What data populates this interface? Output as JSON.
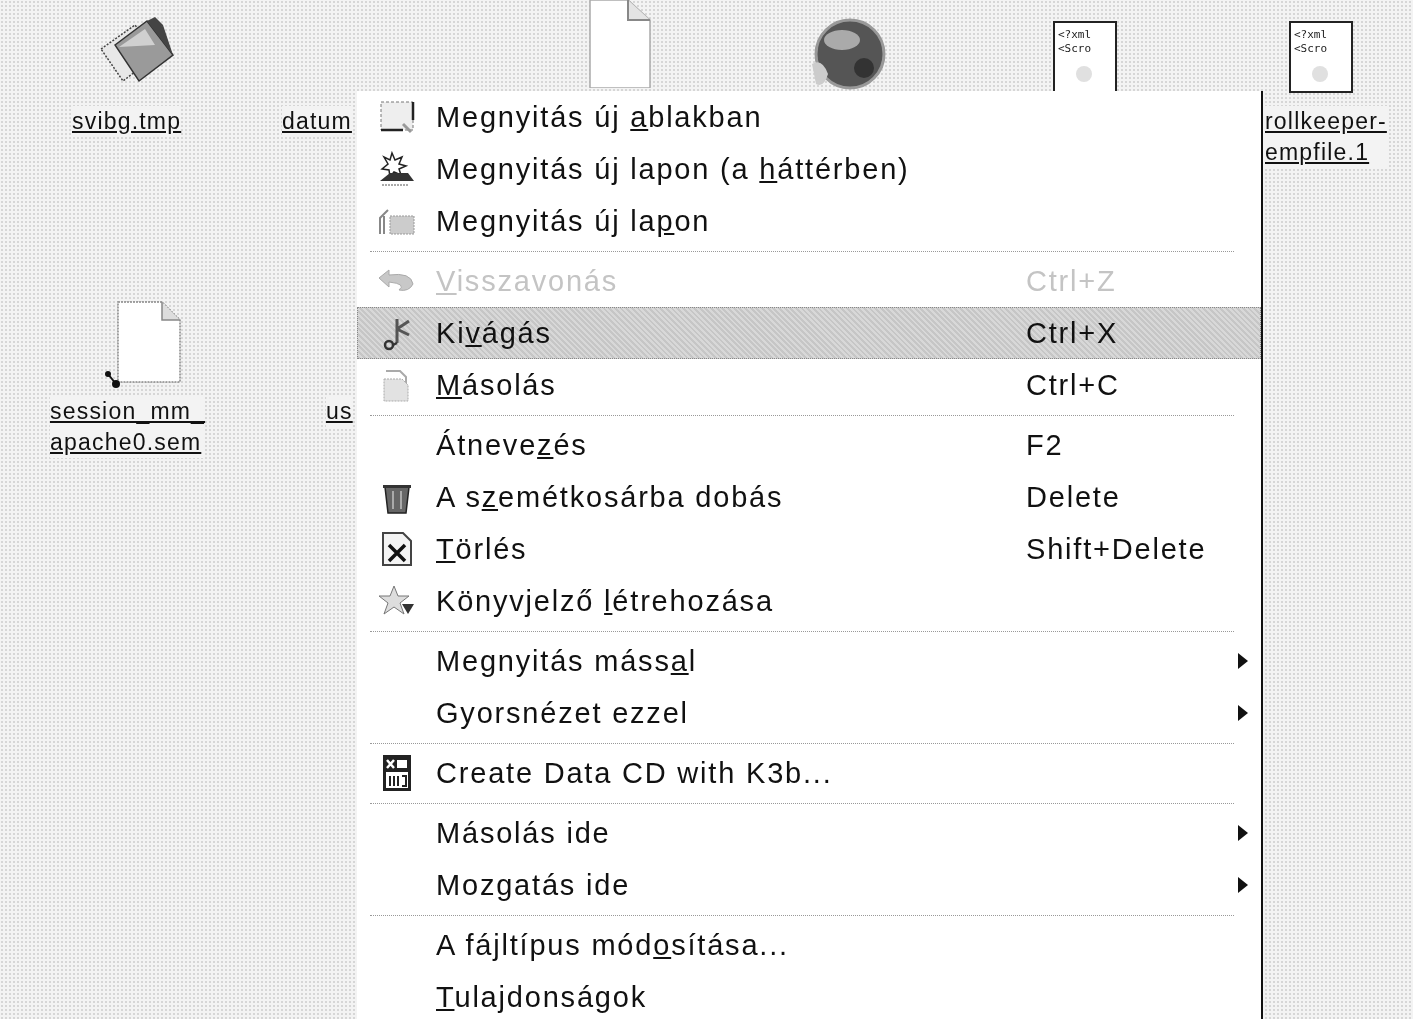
{
  "desktop_icons": [
    {
      "kind": "package",
      "label_lines": [
        "svibg.tmp"
      ]
    },
    {
      "kind": "label_only",
      "label_lines": [
        "datum"
      ]
    },
    {
      "kind": "document",
      "label_lines": [
        "session_mm_",
        "apache0.sem"
      ]
    },
    {
      "kind": "label_only",
      "label_lines": [
        "us"
      ]
    },
    {
      "kind": "document_top"
    },
    {
      "kind": "globe"
    },
    {
      "kind": "xml",
      "preview": [
        "<?xml",
        "<Scro"
      ]
    },
    {
      "kind": "xml",
      "preview": [
        "<?xml",
        "<Scro"
      ],
      "label_lines": [
        "rollkeeper-",
        "empfile.1"
      ]
    }
  ],
  "context_menu": {
    "items": [
      {
        "kind": "item",
        "label": [
          {
            "text": "Megnyitás új ",
            "underline": false
          },
          {
            "text": "a",
            "underline": true
          },
          {
            "text": "blakban",
            "underline": false
          }
        ],
        "disabled": false,
        "selected": false,
        "submenu": false
      },
      {
        "kind": "item",
        "label": [
          {
            "text": "Megnyitás új lapon (a ",
            "underline": false
          },
          {
            "text": "h",
            "underline": true
          },
          {
            "text": "áttérben)",
            "underline": false
          }
        ],
        "disabled": false,
        "selected": false,
        "submenu": false
      },
      {
        "kind": "item",
        "label": [
          {
            "text": "Megnyitás új la",
            "underline": false
          },
          {
            "text": "p",
            "underline": true
          },
          {
            "text": "on",
            "underline": false
          }
        ],
        "disabled": false,
        "selected": false,
        "submenu": false
      },
      {
        "kind": "separator"
      },
      {
        "kind": "item",
        "label": [
          {
            "text": "V",
            "underline": true
          },
          {
            "text": "isszavonás",
            "underline": false
          }
        ],
        "shortcut": "Ctrl+Z",
        "disabled": true,
        "selected": false,
        "submenu": false
      },
      {
        "kind": "item",
        "label": [
          {
            "text": "Ki",
            "underline": false
          },
          {
            "text": "v",
            "underline": true
          },
          {
            "text": "ágás",
            "underline": false
          }
        ],
        "shortcut": "Ctrl+X",
        "disabled": false,
        "selected": true,
        "submenu": false
      },
      {
        "kind": "item",
        "label": [
          {
            "text": "M",
            "underline": true
          },
          {
            "text": "ásolás",
            "underline": false
          }
        ],
        "shortcut": "Ctrl+C",
        "disabled": false,
        "selected": false,
        "submenu": false
      },
      {
        "kind": "separator"
      },
      {
        "kind": "item",
        "label": [
          {
            "text": "Átneve",
            "underline": false
          },
          {
            "text": "z",
            "underline": true
          },
          {
            "text": "és",
            "underline": false
          }
        ],
        "shortcut": "F2",
        "disabled": false,
        "selected": false,
        "submenu": false
      },
      {
        "kind": "item",
        "label": [
          {
            "text": "A s",
            "underline": false
          },
          {
            "text": "z",
            "underline": true
          },
          {
            "text": "emétkosárba dobás",
            "underline": false
          }
        ],
        "shortcut": "Delete",
        "disabled": false,
        "selected": false,
        "submenu": false
      },
      {
        "kind": "item",
        "label": [
          {
            "text": "T",
            "underline": true
          },
          {
            "text": "örlés",
            "underline": false
          }
        ],
        "shortcut": "Shift+Delete",
        "disabled": false,
        "selected": false,
        "submenu": false
      },
      {
        "kind": "item",
        "label": [
          {
            "text": "Könyvjelző ",
            "underline": false
          },
          {
            "text": "l",
            "underline": true
          },
          {
            "text": "étrehozása",
            "underline": false
          }
        ],
        "disabled": false,
        "selected": false,
        "submenu": false
      },
      {
        "kind": "separator"
      },
      {
        "kind": "item",
        "label": [
          {
            "text": "Megnyitás máss",
            "underline": false
          },
          {
            "text": "a",
            "underline": true
          },
          {
            "text": "l",
            "underline": false
          }
        ],
        "disabled": false,
        "selected": false,
        "submenu": true
      },
      {
        "kind": "item",
        "label": [
          {
            "text": "Gyorsnézet ezzel",
            "underline": false
          }
        ],
        "disabled": false,
        "selected": false,
        "submenu": true
      },
      {
        "kind": "separator"
      },
      {
        "kind": "item",
        "label": [
          {
            "text": "Create Data CD with K3b...",
            "underline": false
          }
        ],
        "disabled": false,
        "selected": false,
        "submenu": false
      },
      {
        "kind": "separator"
      },
      {
        "kind": "item",
        "label": [
          {
            "text": "Másolás ide",
            "underline": false
          }
        ],
        "disabled": false,
        "selected": false,
        "submenu": true
      },
      {
        "kind": "item",
        "label": [
          {
            "text": "Mozgatás ide",
            "underline": false
          }
        ],
        "disabled": false,
        "selected": false,
        "submenu": true
      },
      {
        "kind": "separator"
      },
      {
        "kind": "item",
        "label": [
          {
            "text": "A fájltípus mód",
            "underline": false
          },
          {
            "text": "o",
            "underline": true
          },
          {
            "text": "sítása...",
            "underline": false
          }
        ],
        "disabled": false,
        "selected": false,
        "submenu": false
      },
      {
        "kind": "item",
        "label": [
          {
            "text": "T",
            "underline": true
          },
          {
            "text": "ulajdonságok",
            "underline": false
          }
        ],
        "disabled": false,
        "selected": false,
        "submenu": false
      }
    ]
  }
}
